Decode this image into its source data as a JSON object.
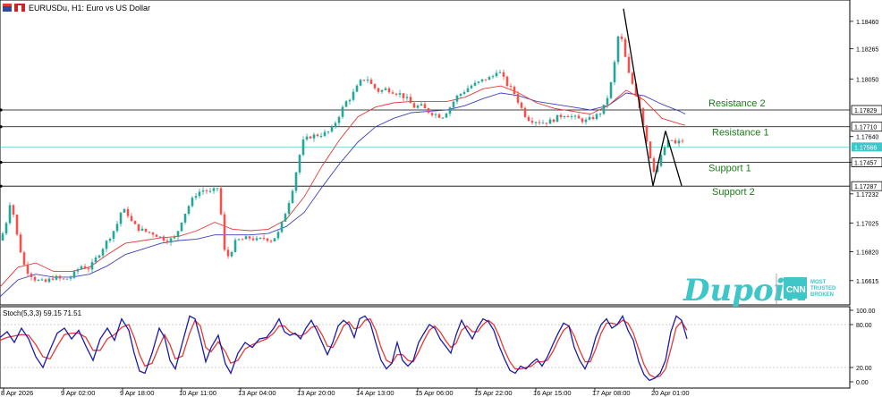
{
  "header": {
    "title": "EURUSDu, H1:  Euro vs US Dollar"
  },
  "levels": [
    {
      "name": "Resistance 2",
      "price": 1.17829
    },
    {
      "name": "Resistance 1",
      "price": 1.1771
    },
    {
      "name": "Support 1",
      "price": 1.17457
    },
    {
      "name": "Support 2",
      "price": 1.17287
    }
  ],
  "current_price": 1.17566,
  "colors": {
    "bull": "#26a69a",
    "bear": "#ef5350",
    "ma_fast": "#e53935",
    "ma_slow": "#3f3fbf",
    "level_text": "#1b7a1b",
    "stoch_main": "#1a1aa6",
    "stoch_signal": "#e53935"
  },
  "logo": {
    "brand": "Dupoin",
    "badge": "CNN",
    "tagline": [
      "MOST",
      "TRUSTED",
      "BROKEN"
    ]
  },
  "stoch": {
    "label": "Stoch(5,3,3) 59.15 71.51",
    "ticks": [
      "100.00",
      "80.00",
      "20.00",
      "0.00"
    ]
  },
  "chart_data": {
    "type": "candlestick",
    "title": "EURUSDu, H1:  Euro vs US Dollar",
    "y_ticks": [
      "1.18460",
      "1.18265",
      "1.18050",
      "1.17640",
      "1.17457",
      "1.17232",
      "1.17025",
      "1.16820",
      "1.16615"
    ],
    "x_ticks": [
      "8 Apr 2026",
      "9 Apr 02:00",
      "9 Apr 18:00",
      "10 Apr 11:00",
      "13 Apr 04:00",
      "13 Apr 20:00",
      "14 Apr 13:00",
      "15 Apr 06:00",
      "15 Apr 22:00",
      "16 Apr 15:00",
      "17 Apr 08:00",
      "20 Apr 01:00"
    ],
    "ylim": [
      1.1648,
      1.1858
    ],
    "close_path": [
      [
        0,
        1.169
      ],
      [
        6,
        1.17
      ],
      [
        12,
        1.172
      ],
      [
        20,
        1.169
      ],
      [
        28,
        1.167
      ],
      [
        40,
        1.1662
      ],
      [
        50,
        1.166
      ],
      [
        60,
        1.1664
      ],
      [
        70,
        1.1662
      ],
      [
        80,
        1.1664
      ],
      [
        90,
        1.1672
      ],
      [
        100,
        1.167
      ],
      [
        110,
        1.168
      ],
      [
        120,
        1.169
      ],
      [
        130,
        1.17
      ],
      [
        136,
        1.1712
      ],
      [
        142,
        1.171
      ],
      [
        148,
        1.1702
      ],
      [
        156,
        1.1698
      ],
      [
        164,
        1.1696
      ],
      [
        172,
        1.1695
      ],
      [
        180,
        1.1692
      ],
      [
        188,
        1.169
      ],
      [
        196,
        1.1692
      ],
      [
        204,
        1.1706
      ],
      [
        212,
        1.1716
      ],
      [
        220,
        1.1724
      ],
      [
        228,
        1.1726
      ],
      [
        236,
        1.1724
      ],
      [
        244,
        1.1728
      ],
      [
        252,
        1.1676
      ],
      [
        258,
        1.1682
      ],
      [
        264,
        1.169
      ],
      [
        272,
        1.1691
      ],
      [
        280,
        1.1692
      ],
      [
        288,
        1.169
      ],
      [
        296,
        1.1692
      ],
      [
        304,
        1.169
      ],
      [
        312,
        1.1696
      ],
      [
        320,
        1.1712
      ],
      [
        326,
        1.1724
      ],
      [
        332,
        1.1742
      ],
      [
        338,
        1.176
      ],
      [
        346,
        1.1764
      ],
      [
        354,
        1.1765
      ],
      [
        362,
        1.1766
      ],
      [
        370,
        1.1768
      ],
      [
        378,
        1.1778
      ],
      [
        386,
        1.1788
      ],
      [
        392,
        1.1792
      ],
      [
        398,
        1.1798
      ],
      [
        404,
        1.1804
      ],
      [
        410,
        1.1806
      ],
      [
        416,
        1.18
      ],
      [
        424,
        1.1796
      ],
      [
        432,
        1.1798
      ],
      [
        440,
        1.1796
      ],
      [
        448,
        1.1794
      ],
      [
        456,
        1.179
      ],
      [
        462,
        1.1785
      ],
      [
        470,
        1.1786
      ],
      [
        478,
        1.1782
      ],
      [
        486,
        1.178
      ],
      [
        494,
        1.1778
      ],
      [
        502,
        1.1784
      ],
      [
        510,
        1.1792
      ],
      [
        518,
        1.1796
      ],
      [
        526,
        1.18
      ],
      [
        534,
        1.1802
      ],
      [
        542,
        1.1805
      ],
      [
        550,
        1.1806
      ],
      [
        556,
        1.1812
      ],
      [
        562,
        1.1806
      ],
      [
        568,
        1.18
      ],
      [
        574,
        1.1796
      ],
      [
        580,
        1.1788
      ],
      [
        586,
        1.178
      ],
      [
        592,
        1.1776
      ],
      [
        600,
        1.1775
      ],
      [
        608,
        1.1774
      ],
      [
        616,
        1.1775
      ],
      [
        624,
        1.1778
      ],
      [
        632,
        1.178
      ],
      [
        640,
        1.1778
      ],
      [
        648,
        1.1776
      ],
      [
        656,
        1.1775
      ],
      [
        664,
        1.1778
      ],
      [
        670,
        1.178
      ],
      [
        676,
        1.1786
      ],
      [
        682,
        1.1798
      ],
      [
        688,
        1.182
      ],
      [
        692,
        1.184
      ],
      [
        696,
        1.183
      ],
      [
        702,
        1.181
      ],
      [
        708,
        1.18
      ],
      [
        714,
        1.1788
      ],
      [
        720,
        1.177
      ],
      [
        726,
        1.1752
      ],
      [
        732,
        1.1738
      ],
      [
        738,
        1.1748
      ],
      [
        744,
        1.1758
      ],
      [
        750,
        1.1762
      ],
      [
        756,
        1.1758
      ],
      [
        762,
        1.1762
      ],
      [
        766,
        1.1758
      ]
    ],
    "ma_fast_path": [
      [
        0,
        1.1657
      ],
      [
        20,
        1.1671
      ],
      [
        40,
        1.1674
      ],
      [
        60,
        1.1668
      ],
      [
        80,
        1.1668
      ],
      [
        100,
        1.1671
      ],
      [
        120,
        1.168
      ],
      [
        140,
        1.1688
      ],
      [
        160,
        1.169
      ],
      [
        180,
        1.1692
      ],
      [
        200,
        1.1693
      ],
      [
        220,
        1.1697
      ],
      [
        240,
        1.1703
      ],
      [
        260,
        1.1698
      ],
      [
        280,
        1.1697
      ],
      [
        300,
        1.1698
      ],
      [
        320,
        1.1705
      ],
      [
        340,
        1.1721
      ],
      [
        360,
        1.1743
      ],
      [
        380,
        1.1762
      ],
      [
        400,
        1.1778
      ],
      [
        420,
        1.1785
      ],
      [
        440,
        1.1788
      ],
      [
        460,
        1.1789
      ],
      [
        480,
        1.1789
      ],
      [
        500,
        1.1789
      ],
      [
        520,
        1.1792
      ],
      [
        540,
        1.1798
      ],
      [
        560,
        1.18
      ],
      [
        580,
        1.1795
      ],
      [
        600,
        1.1788
      ],
      [
        620,
        1.1784
      ],
      [
        640,
        1.1782
      ],
      [
        660,
        1.178
      ],
      [
        680,
        1.1786
      ],
      [
        700,
        1.1797
      ],
      [
        720,
        1.179
      ],
      [
        740,
        1.1777
      ],
      [
        760,
        1.1773
      ],
      [
        766,
        1.1772
      ]
    ],
    "ma_slow_path": [
      [
        0,
        1.165
      ],
      [
        20,
        1.1662
      ],
      [
        40,
        1.1666
      ],
      [
        60,
        1.1664
      ],
      [
        80,
        1.1664
      ],
      [
        100,
        1.1666
      ],
      [
        120,
        1.1672
      ],
      [
        140,
        1.168
      ],
      [
        160,
        1.1684
      ],
      [
        180,
        1.1688
      ],
      [
        200,
        1.169
      ],
      [
        220,
        1.1691
      ],
      [
        240,
        1.1694
      ],
      [
        260,
        1.1694
      ],
      [
        280,
        1.1694
      ],
      [
        300,
        1.1695
      ],
      [
        320,
        1.17
      ],
      [
        340,
        1.171
      ],
      [
        360,
        1.1728
      ],
      [
        380,
        1.1745
      ],
      [
        400,
        1.176
      ],
      [
        420,
        1.1771
      ],
      [
        440,
        1.1777
      ],
      [
        460,
        1.1781
      ],
      [
        480,
        1.1782
      ],
      [
        500,
        1.1783
      ],
      [
        520,
        1.1786
      ],
      [
        540,
        1.1791
      ],
      [
        560,
        1.1795
      ],
      [
        580,
        1.1793
      ],
      [
        600,
        1.1789
      ],
      [
        620,
        1.1787
      ],
      [
        640,
        1.1785
      ],
      [
        660,
        1.1783
      ],
      [
        680,
        1.1786
      ],
      [
        700,
        1.1795
      ],
      [
        720,
        1.1793
      ],
      [
        740,
        1.1787
      ],
      [
        760,
        1.1782
      ],
      [
        766,
        1.178
      ]
    ],
    "pattern_lines": [
      [
        [
          697,
          1.1855
        ],
        [
          730,
          1.1729
        ]
      ],
      [
        [
          730,
          1.1729
        ],
        [
          744,
          1.1768
        ]
      ],
      [
        [
          744,
          1.1768
        ],
        [
          762,
          1.1729
        ]
      ]
    ],
    "stoch_main": [
      [
        0,
        62
      ],
      [
        8,
        70
      ],
      [
        16,
        55
      ],
      [
        24,
        75
      ],
      [
        32,
        60
      ],
      [
        40,
        35
      ],
      [
        48,
        20
      ],
      [
        56,
        45
      ],
      [
        64,
        68
      ],
      [
        72,
        75
      ],
      [
        80,
        60
      ],
      [
        88,
        72
      ],
      [
        96,
        50
      ],
      [
        104,
        30
      ],
      [
        112,
        60
      ],
      [
        120,
        75
      ],
      [
        128,
        58
      ],
      [
        136,
        88
      ],
      [
        144,
        72
      ],
      [
        150,
        40
      ],
      [
        156,
        15
      ],
      [
        162,
        12
      ],
      [
        170,
        40
      ],
      [
        178,
        75
      ],
      [
        184,
        62
      ],
      [
        190,
        30
      ],
      [
        196,
        18
      ],
      [
        204,
        55
      ],
      [
        212,
        92
      ],
      [
        218,
        88
      ],
      [
        224,
        60
      ],
      [
        230,
        28
      ],
      [
        236,
        48
      ],
      [
        244,
        65
      ],
      [
        252,
        25
      ],
      [
        258,
        12
      ],
      [
        266,
        40
      ],
      [
        274,
        55
      ],
      [
        282,
        48
      ],
      [
        290,
        60
      ],
      [
        298,
        62
      ],
      [
        306,
        75
      ],
      [
        312,
        88
      ],
      [
        318,
        70
      ],
      [
        324,
        65
      ],
      [
        330,
        68
      ],
      [
        336,
        60
      ],
      [
        342,
        75
      ],
      [
        348,
        86
      ],
      [
        354,
        72
      ],
      [
        360,
        55
      ],
      [
        366,
        38
      ],
      [
        372,
        55
      ],
      [
        378,
        78
      ],
      [
        384,
        86
      ],
      [
        390,
        80
      ],
      [
        396,
        62
      ],
      [
        402,
        88
      ],
      [
        408,
        92
      ],
      [
        414,
        82
      ],
      [
        420,
        55
      ],
      [
        426,
        30
      ],
      [
        432,
        18
      ],
      [
        438,
        26
      ],
      [
        444,
        55
      ],
      [
        450,
        30
      ],
      [
        456,
        22
      ],
      [
        462,
        30
      ],
      [
        468,
        55
      ],
      [
        474,
        68
      ],
      [
        480,
        80
      ],
      [
        486,
        75
      ],
      [
        492,
        60
      ],
      [
        498,
        50
      ],
      [
        504,
        40
      ],
      [
        510,
        66
      ],
      [
        516,
        86
      ],
      [
        522,
        72
      ],
      [
        528,
        60
      ],
      [
        534,
        76
      ],
      [
        540,
        88
      ],
      [
        546,
        84
      ],
      [
        552,
        72
      ],
      [
        558,
        50
      ],
      [
        564,
        32
      ],
      [
        570,
        16
      ],
      [
        576,
        12
      ],
      [
        582,
        22
      ],
      [
        588,
        18
      ],
      [
        594,
        26
      ],
      [
        600,
        32
      ],
      [
        606,
        22
      ],
      [
        612,
        35
      ],
      [
        618,
        52
      ],
      [
        624,
        68
      ],
      [
        630,
        82
      ],
      [
        636,
        78
      ],
      [
        642,
        48
      ],
      [
        648,
        30
      ],
      [
        654,
        18
      ],
      [
        660,
        35
      ],
      [
        666,
        62
      ],
      [
        672,
        80
      ],
      [
        678,
        88
      ],
      [
        684,
        75
      ],
      [
        690,
        80
      ],
      [
        696,
        92
      ],
      [
        702,
        72
      ],
      [
        708,
        58
      ],
      [
        714,
        28
      ],
      [
        720,
        10
      ],
      [
        726,
        2
      ],
      [
        732,
        5
      ],
      [
        738,
        12
      ],
      [
        744,
        30
      ],
      [
        750,
        70
      ],
      [
        756,
        92
      ],
      [
        762,
        86
      ],
      [
        768,
        60
      ]
    ],
    "stoch_signal": [
      [
        0,
        58
      ],
      [
        8,
        62
      ],
      [
        16,
        64
      ],
      [
        24,
        66
      ],
      [
        32,
        65
      ],
      [
        40,
        52
      ],
      [
        48,
        35
      ],
      [
        56,
        32
      ],
      [
        64,
        50
      ],
      [
        72,
        66
      ],
      [
        80,
        68
      ],
      [
        88,
        68
      ],
      [
        96,
        62
      ],
      [
        104,
        44
      ],
      [
        112,
        44
      ],
      [
        120,
        60
      ],
      [
        128,
        66
      ],
      [
        136,
        76
      ],
      [
        144,
        80
      ],
      [
        150,
        62
      ],
      [
        156,
        38
      ],
      [
        162,
        22
      ],
      [
        170,
        26
      ],
      [
        178,
        50
      ],
      [
        184,
        66
      ],
      [
        190,
        52
      ],
      [
        196,
        32
      ],
      [
        204,
        36
      ],
      [
        212,
        68
      ],
      [
        218,
        86
      ],
      [
        224,
        78
      ],
      [
        230,
        48
      ],
      [
        236,
        42
      ],
      [
        244,
        56
      ],
      [
        252,
        42
      ],
      [
        258,
        26
      ],
      [
        266,
        30
      ],
      [
        274,
        46
      ],
      [
        282,
        52
      ],
      [
        290,
        56
      ],
      [
        298,
        60
      ],
      [
        306,
        68
      ],
      [
        312,
        78
      ],
      [
        318,
        78
      ],
      [
        324,
        70
      ],
      [
        330,
        66
      ],
      [
        336,
        64
      ],
      [
        342,
        68
      ],
      [
        348,
        76
      ],
      [
        354,
        78
      ],
      [
        360,
        66
      ],
      [
        366,
        50
      ],
      [
        372,
        48
      ],
      [
        378,
        62
      ],
      [
        384,
        78
      ],
      [
        390,
        84
      ],
      [
        396,
        74
      ],
      [
        402,
        76
      ],
      [
        408,
        86
      ],
      [
        414,
        88
      ],
      [
        420,
        72
      ],
      [
        426,
        48
      ],
      [
        432,
        30
      ],
      [
        438,
        26
      ],
      [
        444,
        38
      ],
      [
        450,
        38
      ],
      [
        456,
        30
      ],
      [
        462,
        28
      ],
      [
        468,
        42
      ],
      [
        474,
        58
      ],
      [
        480,
        72
      ],
      [
        486,
        78
      ],
      [
        492,
        70
      ],
      [
        498,
        58
      ],
      [
        504,
        48
      ],
      [
        510,
        54
      ],
      [
        516,
        72
      ],
      [
        522,
        78
      ],
      [
        528,
        70
      ],
      [
        534,
        70
      ],
      [
        540,
        80
      ],
      [
        546,
        86
      ],
      [
        552,
        80
      ],
      [
        558,
        64
      ],
      [
        564,
        44
      ],
      [
        570,
        28
      ],
      [
        576,
        18
      ],
      [
        582,
        18
      ],
      [
        588,
        20
      ],
      [
        594,
        22
      ],
      [
        600,
        28
      ],
      [
        606,
        28
      ],
      [
        612,
        30
      ],
      [
        618,
        42
      ],
      [
        624,
        58
      ],
      [
        630,
        72
      ],
      [
        636,
        78
      ],
      [
        642,
        64
      ],
      [
        648,
        44
      ],
      [
        654,
        28
      ],
      [
        660,
        28
      ],
      [
        666,
        46
      ],
      [
        672,
        68
      ],
      [
        678,
        82
      ],
      [
        684,
        82
      ],
      [
        690,
        80
      ],
      [
        696,
        86
      ],
      [
        702,
        82
      ],
      [
        708,
        68
      ],
      [
        714,
        46
      ],
      [
        720,
        24
      ],
      [
        726,
        10
      ],
      [
        732,
        6
      ],
      [
        738,
        8
      ],
      [
        744,
        18
      ],
      [
        750,
        46
      ],
      [
        756,
        76
      ],
      [
        762,
        84
      ],
      [
        768,
        72
      ]
    ]
  }
}
